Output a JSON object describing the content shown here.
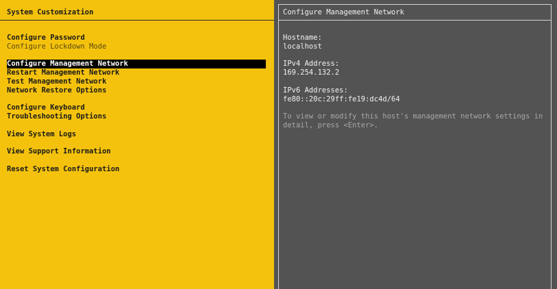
{
  "left_panel": {
    "title": "System Customization",
    "menu": [
      {
        "label": "Configure Password"
      },
      {
        "label": "Configure Lockdown Mode"
      },
      {
        "label": "Configure Management Network"
      },
      {
        "label": "Restart Management Network"
      },
      {
        "label": "Test Management Network"
      },
      {
        "label": "Network Restore Options"
      },
      {
        "label": "Configure Keyboard"
      },
      {
        "label": "Troubleshooting Options"
      },
      {
        "label": "View System Logs"
      },
      {
        "label": "View Support Information"
      },
      {
        "label": "Reset System Configuration"
      }
    ],
    "selected_label": "Configure Management Network"
  },
  "right_panel": {
    "title": "Configure Management Network",
    "hostname_label": "Hostname:",
    "hostname_value": "localhost",
    "ipv4_label": "IPv4 Address:",
    "ipv4_value": "169.254.132.2",
    "ipv6_label": "IPv6 Addresses:",
    "ipv6_value": "fe80::20c:29ff:fe19:dc4d/64",
    "help_text": "To view or modify this host's management network settings in detail, press <Enter>."
  },
  "colors": {
    "left_background": "#f4c20d",
    "right_background": "#535353",
    "selection_background": "#000000"
  }
}
